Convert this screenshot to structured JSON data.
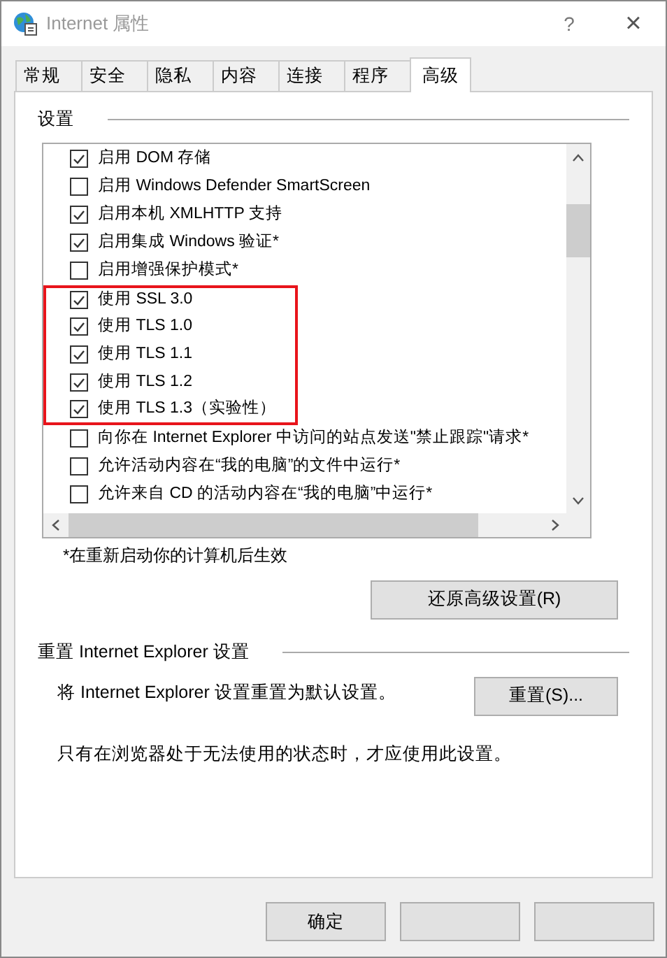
{
  "window": {
    "title": "Internet 属性",
    "help": "?",
    "close": "×"
  },
  "tabs": [
    {
      "label": "常规",
      "selected": false
    },
    {
      "label": "安全",
      "selected": false
    },
    {
      "label": "隐私",
      "selected": false
    },
    {
      "label": "内容",
      "selected": false
    },
    {
      "label": "连接",
      "selected": false
    },
    {
      "label": "程序",
      "selected": false
    },
    {
      "label": "高级",
      "selected": true
    }
  ],
  "settings": {
    "title": "设置",
    "items": [
      {
        "label": "启用 DOM 存储",
        "checked": true,
        "highlighted": false
      },
      {
        "label": "启用 Windows Defender SmartScreen",
        "checked": false,
        "highlighted": false
      },
      {
        "label": "启用本机 XMLHTTP 支持",
        "checked": true,
        "highlighted": false
      },
      {
        "label": "启用集成 Windows 验证*",
        "checked": true,
        "highlighted": false
      },
      {
        "label": "启用增强保护模式*",
        "checked": false,
        "highlighted": false
      },
      {
        "label": "使用 SSL 3.0",
        "checked": true,
        "highlighted": true
      },
      {
        "label": "使用 TLS 1.0",
        "checked": true,
        "highlighted": true
      },
      {
        "label": "使用 TLS 1.1",
        "checked": true,
        "highlighted": true
      },
      {
        "label": "使用 TLS 1.2",
        "checked": true,
        "highlighted": true
      },
      {
        "label": "使用 TLS 1.3（实验性）",
        "checked": true,
        "highlighted": true
      },
      {
        "label": "向你在 Internet Explorer 中访问的站点发送\"禁止跟踪\"请求*",
        "checked": false,
        "highlighted": false
      },
      {
        "label": "允许活动内容在“我的电脑”的文件中运行*",
        "checked": false,
        "highlighted": false
      },
      {
        "label": "允许来自 CD 的活动内容在“我的电脑”中运行*",
        "checked": false,
        "highlighted": false
      }
    ],
    "note": "*在重新启动你的计算机后生效",
    "restore_button": "还原高级设置(R)"
  },
  "reset": {
    "title": "重置 Internet Explorer 设置",
    "description": "将 Internet Explorer 设置重置为默认设置。",
    "button": "重置(S)...",
    "hint": "只有在浏览器处于无法使用的状态时，才应使用此设置。"
  },
  "buttons": [
    {
      "kind": "text",
      "label": "确定"
    },
    {
      "kind": "covered"
    },
    {
      "kind": "covered"
    }
  ]
}
